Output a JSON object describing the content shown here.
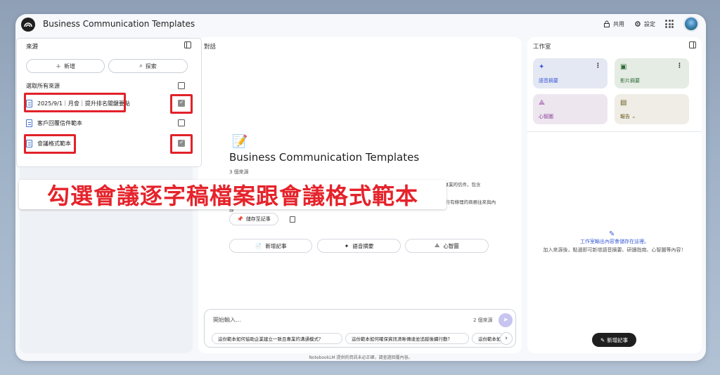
{
  "app": {
    "title": "Business Communication Templates",
    "share_label": "共用",
    "settings_label": "設定"
  },
  "source_panel": {
    "header": "來源",
    "add_label": "新增",
    "search_label": "探索",
    "select_all_label": "選取所有來源",
    "items": [
      {
        "label": "2025/9/1｜月會｜提升排名關鍵要點",
        "checked": true
      },
      {
        "label": "客戶回覆信件範本",
        "checked": false
      },
      {
        "label": "會議格式範本",
        "checked": true
      }
    ]
  },
  "chat_panel": {
    "header": "對話",
    "emoji": "📝",
    "title": "Business Communication Templates",
    "source_count": "3 個來源",
    "summary": "這些來源提供了正式商業溝通的組織化範本，第一份文件是客戶回覆信件的格式範本，指導使用者如何撰寫專業的信件，包含",
    "summary_tail": "的範例，另一份範本提供會議紀錄的主要結構，建議了會議的基本資 訊、議程與決議事項，旨在協助企業進行有條理的商務往來與內部",
    "save_note_label": "儲存至記事",
    "chips": [
      {
        "icon": "📄",
        "label": "新增記事"
      },
      {
        "icon": "✦",
        "label": "語音摘要"
      },
      {
        "icon": "⟁",
        "label": "心智圖"
      }
    ],
    "input_placeholder": "開始輸入...",
    "input_source_count": "2 個來源",
    "suggestions": [
      "這份範本如何協助企業建立一致且專業的溝通模式？",
      "這份範本如何確保資訊清晰傳達並追蹤後續行動？",
      "這份範本如何"
    ]
  },
  "studio_panel": {
    "header": "工作室",
    "tiles": [
      {
        "icon": "✦",
        "label": "語音摘要",
        "color": "#e4e8f3"
      },
      {
        "icon": "▣",
        "label": "影片摘要",
        "color": "#e5ece4"
      },
      {
        "icon": "⟁",
        "label": "心智圖",
        "color": "#ede6ef"
      },
      {
        "icon": "▤",
        "label": "報告 ⌄",
        "color": "#efede6"
      }
    ],
    "empty_title": "工作室輸出內容會儲存在這裡。",
    "empty_desc": "加入來源後，點選即可新增語音摘要、研讀指南、心智圖等內容！",
    "add_note_label": "新增記事"
  },
  "footer": "NotebookLM 提供的資訊未必正確，請查證回覆內容。",
  "banner": {
    "text": "勾選會議逐字稿檔案跟會議格式範本",
    "color": "#e5232b"
  }
}
